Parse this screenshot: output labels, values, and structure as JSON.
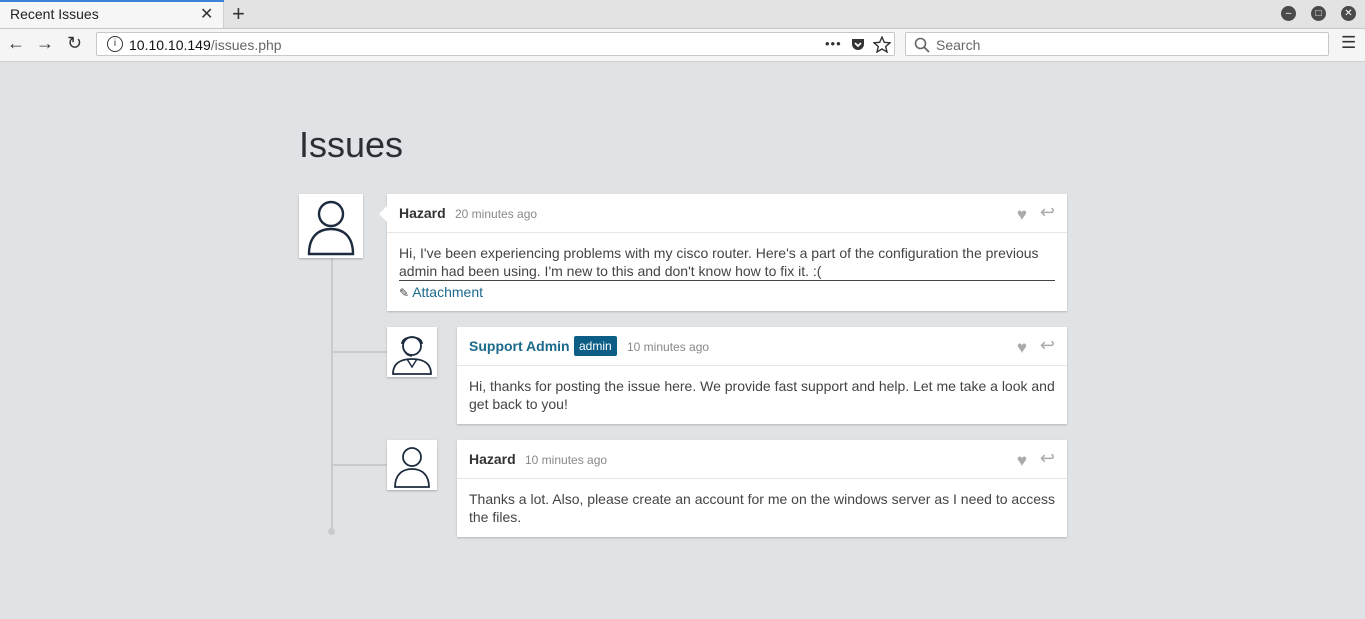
{
  "browser": {
    "tab_title": "Recent Issues",
    "tab_close": "✕",
    "new_tab": "+",
    "url_host": "10.10.10.149",
    "url_path": "/issues.php",
    "url_more": "•••",
    "search_placeholder": "Search",
    "menu": "☰",
    "back": "←",
    "forward": "→",
    "reload": "↻"
  },
  "page": {
    "title": "Issues"
  },
  "posts": [
    {
      "author": "Hazard",
      "time": "20 minutes ago",
      "text": "Hi, I've been experiencing problems with my cisco router. Here's a part of the configuration the previous admin had been using. I'm new to this and don't know how to fix it. :(",
      "attachment": "Attachment"
    },
    {
      "author": "Support Admin",
      "badge": "admin",
      "time": "10 minutes ago",
      "text": "Hi, thanks for posting the issue here. We provide fast support and help. Let me take a look and get back to you!"
    },
    {
      "author": "Hazard",
      "time": "10 minutes ago",
      "text": "Thanks a lot. Also, please create an account for me on the windows server as I need to access the files."
    }
  ]
}
